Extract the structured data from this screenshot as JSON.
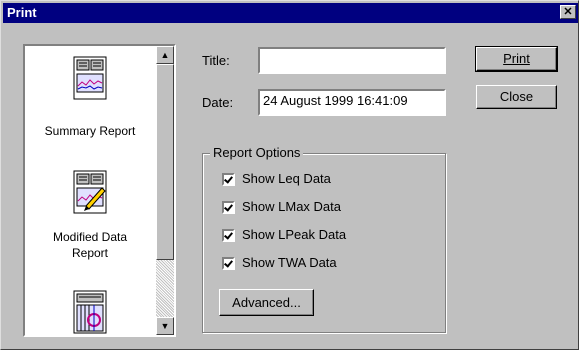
{
  "window": {
    "title": "Print",
    "close_glyph": "✕"
  },
  "report_list": {
    "items": [
      {
        "label": "Summary Report",
        "icon": "summary-report-icon"
      },
      {
        "label": "Modified Data Report",
        "label_line1": "Modified Data",
        "label_line2": "Report",
        "icon": "modified-data-report-icon"
      },
      {
        "label": "",
        "icon": "chart-report-icon"
      }
    ]
  },
  "form": {
    "title_label": "Title:",
    "title_value": "",
    "date_label": "Date:",
    "date_value": "24 August 1999 16:41:09"
  },
  "buttons": {
    "print": "Print",
    "close": "Close",
    "advanced": "Advanced..."
  },
  "report_options": {
    "group_title": "Report Options",
    "checkboxes": [
      {
        "label": "Show Leq Data",
        "checked": true
      },
      {
        "label": "Show LMax Data",
        "checked": true
      },
      {
        "label": "Show LPeak Data",
        "checked": true
      },
      {
        "label": "Show TWA Data",
        "checked": true
      }
    ]
  }
}
